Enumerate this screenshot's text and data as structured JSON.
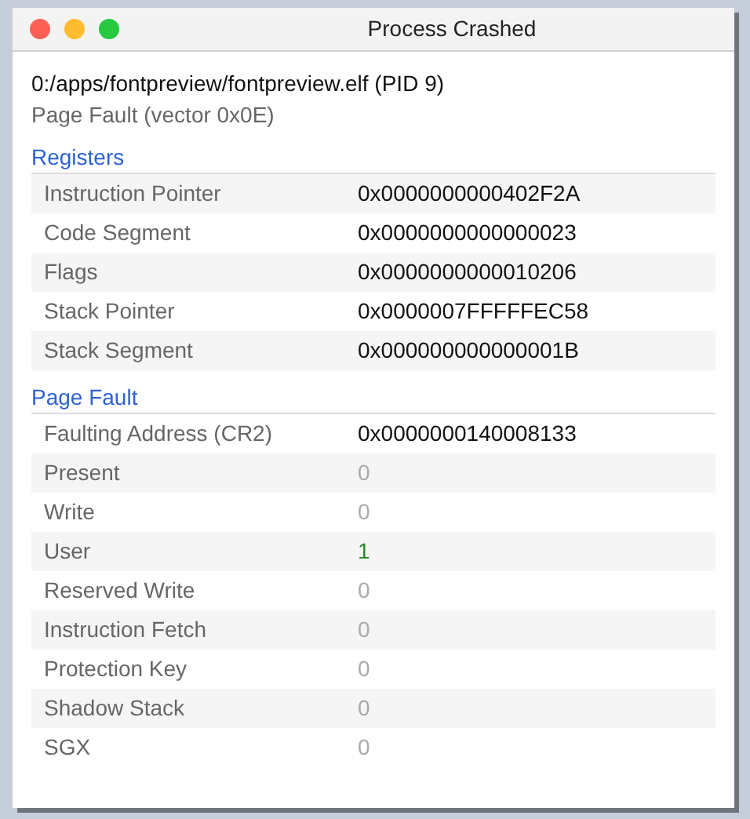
{
  "window": {
    "title": "Process Crashed"
  },
  "process": "0:/apps/fontpreview/fontpreview.elf (PID 9)",
  "fault": "Page Fault (vector 0x0E)",
  "sections": [
    {
      "title": "Registers",
      "rows": [
        {
          "label": "Instruction Pointer",
          "value": "0x0000000000402F2A",
          "kind": "address"
        },
        {
          "label": "Code Segment",
          "value": "0x0000000000000023",
          "kind": "address"
        },
        {
          "label": "Flags",
          "value": "0x0000000000010206",
          "kind": "address"
        },
        {
          "label": "Stack Pointer",
          "value": "0x0000007FFFFFEC58",
          "kind": "address"
        },
        {
          "label": "Stack Segment",
          "value": "0x000000000000001B",
          "kind": "address"
        }
      ]
    },
    {
      "title": "Page Fault",
      "rows": [
        {
          "label": "Faulting Address (CR2)",
          "value": "0x0000000140008133",
          "kind": "address"
        },
        {
          "label": "Present",
          "value": "0",
          "kind": "flag",
          "on": false
        },
        {
          "label": "Write",
          "value": "0",
          "kind": "flag",
          "on": false
        },
        {
          "label": "User",
          "value": "1",
          "kind": "flag",
          "on": true
        },
        {
          "label": "Reserved Write",
          "value": "0",
          "kind": "flag",
          "on": false
        },
        {
          "label": "Instruction Fetch",
          "value": "0",
          "kind": "flag",
          "on": false
        },
        {
          "label": "Protection Key",
          "value": "0",
          "kind": "flag",
          "on": false
        },
        {
          "label": "Shadow Stack",
          "value": "0",
          "kind": "flag",
          "on": false
        },
        {
          "label": "SGX",
          "value": "0",
          "kind": "flag",
          "on": false
        }
      ]
    }
  ]
}
